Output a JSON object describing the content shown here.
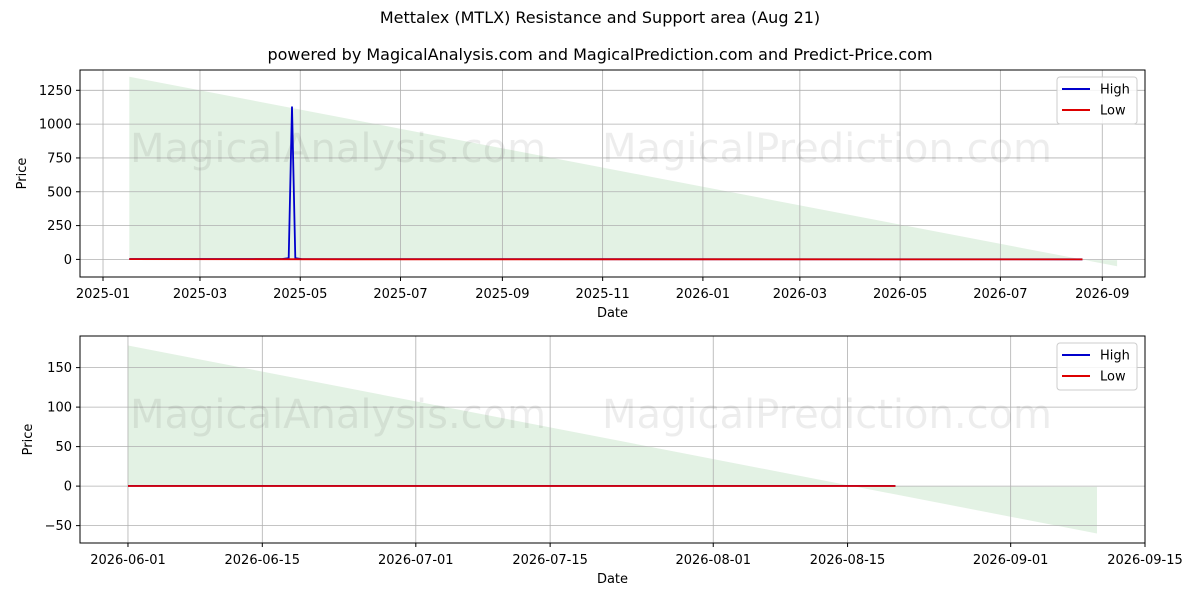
{
  "title": "Mettalex (MTLX) Resistance and Support area (Aug 21)",
  "subtitle": "powered by MagicalAnalysis.com and MagicalPrediction.com and Predict-Price.com",
  "watermarks": [
    "MagicalAnalysis.com",
    "MagicalPrediction.com"
  ],
  "colors": {
    "high": "#0000cc",
    "low": "#dd0000",
    "band": "#c8e6c9",
    "grid": "#b0b0b0"
  },
  "chart_data": [
    {
      "type": "line",
      "xlabel": "Date",
      "ylabel": "Price",
      "x_axis_type": "date",
      "xlim": [
        "2024-12-18",
        "2026-09-27"
      ],
      "ylim": [
        -130,
        1400
      ],
      "xticks": [
        "2025-01-01",
        "2025-03-01",
        "2025-05-01",
        "2025-07-01",
        "2025-09-01",
        "2025-11-01",
        "2026-01-01",
        "2026-03-01",
        "2026-05-01",
        "2026-07-01",
        "2026-09-01"
      ],
      "xtick_labels": [
        "2025-01",
        "2025-03",
        "2025-05",
        "2025-07",
        "2025-09",
        "2025-11",
        "2026-01",
        "2026-03",
        "2026-05",
        "2026-07",
        "2026-09"
      ],
      "yticks": [
        0,
        250,
        500,
        750,
        1000,
        1250
      ],
      "ytick_labels": [
        "0",
        "250",
        "500",
        "750",
        "1000",
        "1250"
      ],
      "grid": true,
      "legend_position": "top-right",
      "band": {
        "x": [
          "2025-01-17",
          "2026-09-10",
          "2026-09-10",
          "2025-01-17"
        ],
        "y": [
          1350,
          -50,
          -5,
          5
        ]
      },
      "series": [
        {
          "name": "High",
          "color": "#0000cc",
          "x": [
            "2025-01-17",
            "2025-04-20",
            "2025-04-24",
            "2025-04-26",
            "2025-04-28",
            "2025-05-02",
            "2026-08-20"
          ],
          "y": [
            3,
            3,
            10,
            1130,
            10,
            2,
            1
          ]
        },
        {
          "name": "Low",
          "color": "#dd0000",
          "x": [
            "2025-01-17",
            "2025-06-01",
            "2026-01-01",
            "2026-08-20"
          ],
          "y": [
            2,
            1,
            0.5,
            0.3
          ]
        }
      ]
    },
    {
      "type": "line",
      "xlabel": "Date",
      "ylabel": "Price",
      "x_axis_type": "date",
      "xlim": [
        "2026-05-27",
        "2026-09-15"
      ],
      "ylim": [
        -72,
        190
      ],
      "xticks": [
        "2026-06-01",
        "2026-06-15",
        "2026-07-01",
        "2026-07-15",
        "2026-08-01",
        "2026-08-15",
        "2026-09-01",
        "2026-09-15"
      ],
      "xtick_labels": [
        "2026-06-01",
        "2026-06-15",
        "2026-07-01",
        "2026-07-15",
        "2026-08-01",
        "2026-08-15",
        "2026-09-01",
        "2026-09-15"
      ],
      "yticks": [
        -50,
        0,
        50,
        100,
        150
      ],
      "ytick_labels": [
        "−50",
        "0",
        "50",
        "100",
        "150"
      ],
      "grid": true,
      "legend_position": "top-right",
      "band": {
        "x": [
          "2026-06-01",
          "2026-09-10",
          "2026-09-10",
          "2026-06-01"
        ],
        "y": [
          178,
          -60,
          -1,
          1
        ]
      },
      "series": [
        {
          "name": "High",
          "color": "#0000cc",
          "x": [
            "2026-06-01",
            "2026-08-20"
          ],
          "y": [
            0.3,
            0.3
          ]
        },
        {
          "name": "Low",
          "color": "#dd0000",
          "x": [
            "2026-06-01",
            "2026-08-20"
          ],
          "y": [
            0.2,
            0.2
          ]
        }
      ]
    }
  ]
}
